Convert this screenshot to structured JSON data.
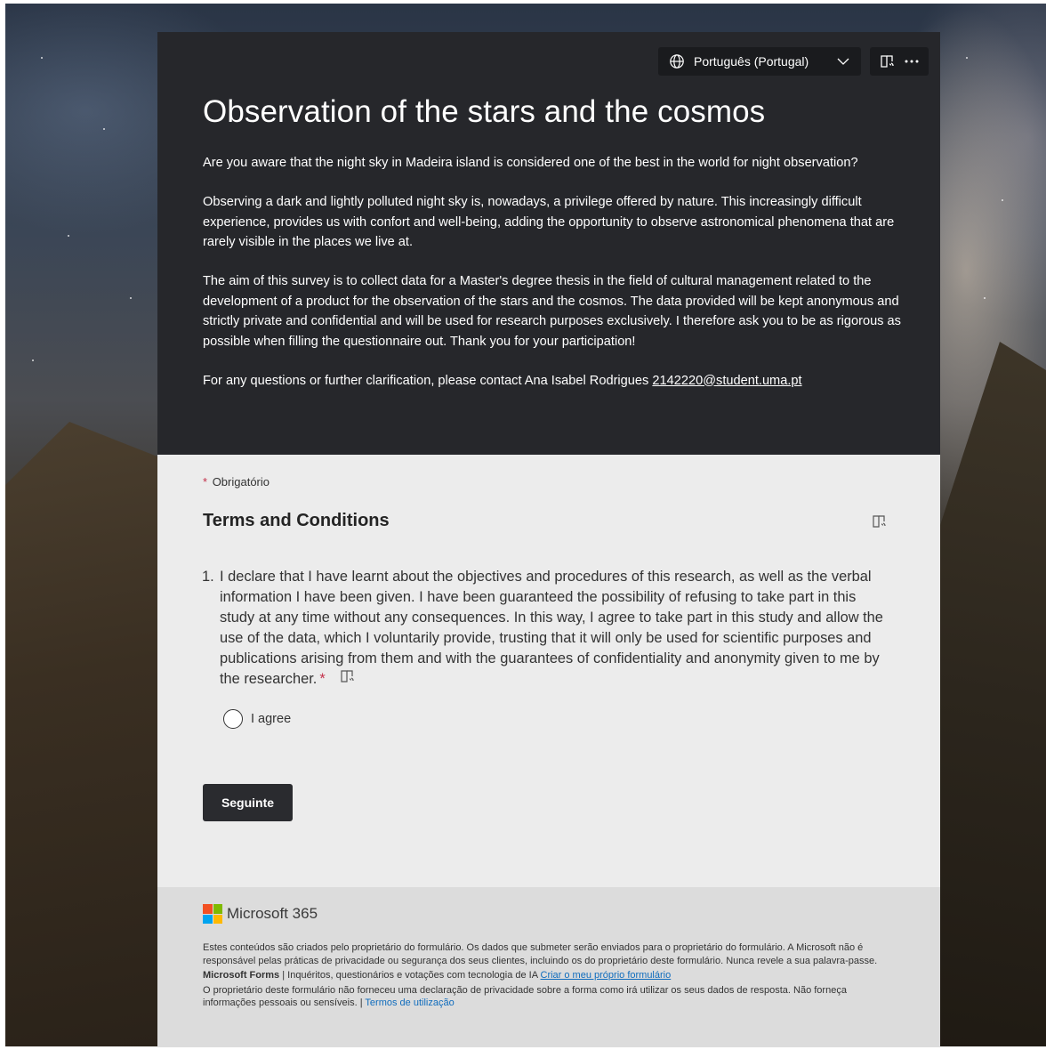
{
  "language_selector": {
    "label": "Português (Portugal)"
  },
  "header": {
    "title": "Observation of the stars and the cosmos",
    "paragraphs": [
      "Are you aware that the night sky in Madeira island is considered one of the best in the world for night observation?",
      "Observing a dark and lightly polluted night sky is, nowadays, a privilege offered by nature. This increasingly difficult experience, provides us with confort and well-being, adding the opportunity to observe astronomical phenomena that are rarely visible in the places we live at.",
      "The aim of this survey is to collect data for a Master's degree thesis in the field of cultural management related to the development of a product for the observation of the stars and the cosmos. The data provided will be kept anonymous and strictly private and confidential and will be used for research purposes exclusively. I therefore ask you to be as rigorous as possible when filling the questionnaire out. Thank you for your participation!"
    ],
    "contact_text": "For any questions or further clarification, please contact Ana Isabel Rodrigues ",
    "contact_email": "2142220@student.uma.pt"
  },
  "body": {
    "required_asterisk": "*",
    "required_label": "Obrigatório",
    "section_title": "Terms and Conditions",
    "question": {
      "number": "1.",
      "text": "I declare that I have learnt about the objectives and procedures of this research, as well as the verbal information I have been given.  I have been guaranteed the possibility of refusing to take part in this study at any time without any consequences. In this way, I agree to take part in this study and allow the use of the data, which I voluntarily provide, trusting that it will only be used for scientific purposes and publications arising from them and with the guarantees of confidentiality and anonymity given to me by the researcher.",
      "required_asterisk": "*",
      "option_label": "I agree"
    },
    "next_button": "Seguinte"
  },
  "footer": {
    "brand": "Microsoft 365",
    "disclaimer": "Estes conteúdos são criados pelo proprietário do formulário. Os dados que submeter serão enviados para o proprietário do formulário. A Microsoft não é responsável pelas práticas de privacidade ou segurança dos seus clientes, incluindo os do proprietário deste formulário. Nunca revele a sua palavra-passe.",
    "forms_name": "Microsoft Forms",
    "forms_tagline": " | Inquéritos, questionários e votações com tecnologia de IA ",
    "create_link": "Criar o meu próprio formulário",
    "privacy_text": "O proprietário deste formulário não forneceu uma declaração de privacidade sobre a forma como irá utilizar os seus dados de resposta. Não forneça informações pessoais ou sensíveis. | ",
    "terms_link": "Termos de utilização"
  },
  "colors": {
    "header_bg": "#26272b",
    "body_bg": "#ececec",
    "footer_bg": "#dcdcdc",
    "required": "#c4314b",
    "link": "#0f6cbd"
  }
}
